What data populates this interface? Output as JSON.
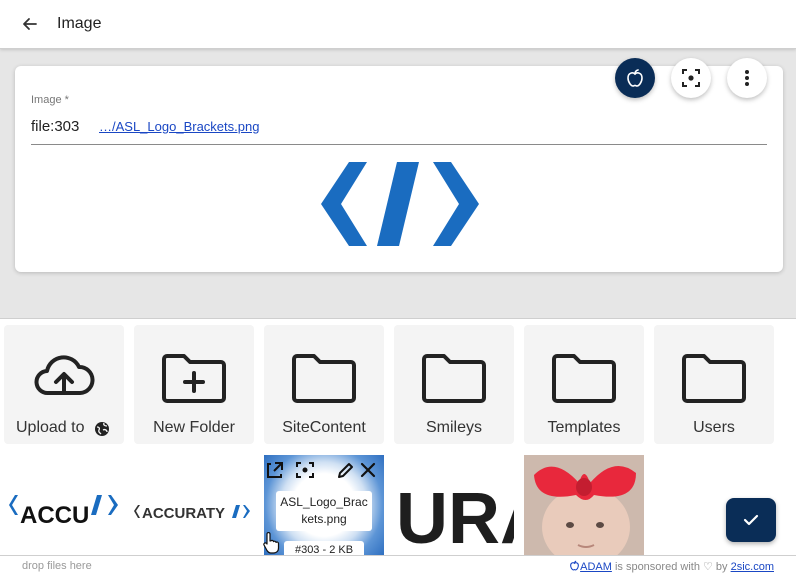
{
  "header": {
    "title": "Image"
  },
  "field": {
    "label": "Image *",
    "value": "file:303",
    "link": "…/ASL_Logo_Brackets.png"
  },
  "tiles": [
    {
      "label": "Upload to"
    },
    {
      "label": "New Folder"
    },
    {
      "label": "SiteContent"
    },
    {
      "label": "Smileys"
    },
    {
      "label": "Templates"
    },
    {
      "label": "Users"
    }
  ],
  "thumbnails": {
    "accu": {
      "text": "ACCU"
    },
    "accuraty": {
      "text": "ACCURATY"
    },
    "asl": {
      "name": "ASL_Logo_Brackets.png",
      "meta": "#303 - 2 KB"
    },
    "ura": {
      "text": "URA"
    }
  },
  "footer": {
    "drop_hint": "drop files here",
    "adam": "ADAM",
    "sponsored": " is sponsored with ♡ by ",
    "sponsor_link": "2sic.com"
  },
  "colors": {
    "accent": "#0a2d57",
    "logo_blue": "#1a6cc0",
    "link": "#1a47c4"
  }
}
